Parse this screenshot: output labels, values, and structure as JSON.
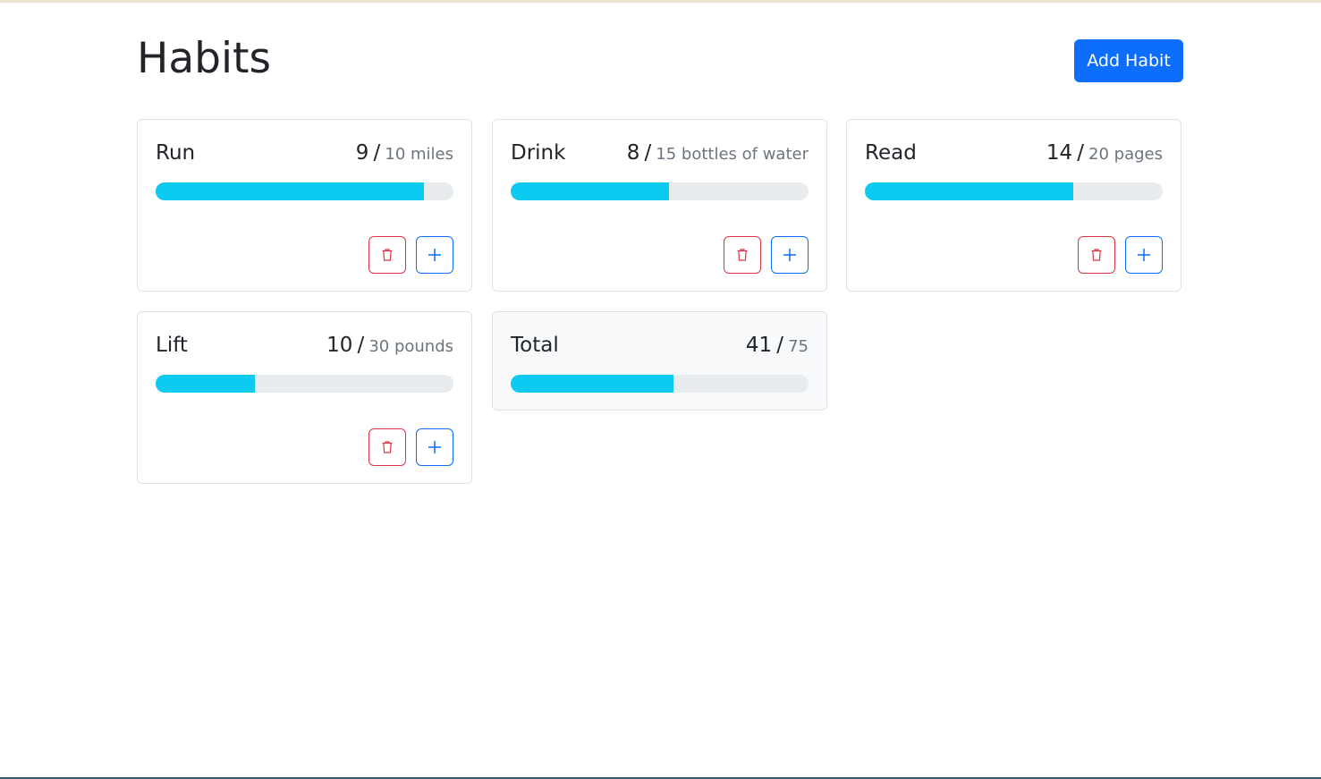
{
  "header": {
    "title": "Habits",
    "add_button_label": "Add Habit"
  },
  "habits": [
    {
      "name": "Run",
      "current": "9",
      "separator": "/",
      "goal": "10 miles",
      "progress": 0.9
    },
    {
      "name": "Drink",
      "current": "8",
      "separator": "/",
      "goal": "15 bottles of water",
      "progress": 0.533
    },
    {
      "name": "Read",
      "current": "14",
      "separator": "/",
      "goal": "20 pages",
      "progress": 0.7
    },
    {
      "name": "Lift",
      "current": "10",
      "separator": "/",
      "goal": "30 pounds",
      "progress": 0.333
    }
  ],
  "total": {
    "name": "Total",
    "current": "41",
    "separator": "/",
    "goal": "75",
    "progress": 0.547
  },
  "icons": {
    "delete": "trash-icon",
    "increment": "plus-icon"
  },
  "colors": {
    "primary": "#0d6efd",
    "danger": "#dc3545",
    "progress_fill": "#0dcaf0",
    "progress_track": "#e9ecef"
  }
}
